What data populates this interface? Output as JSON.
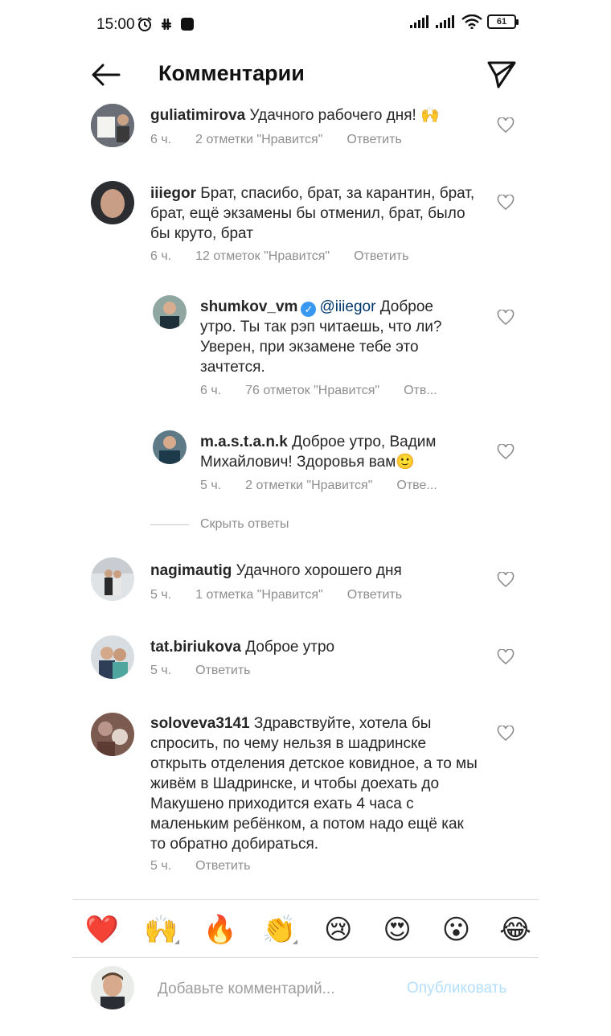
{
  "status": {
    "time": "15:00",
    "battery": "61"
  },
  "header": {
    "title": "Комментарии"
  },
  "comments": [
    {
      "username": "guliatimirova",
      "text": "Удачного рабочего дня! 🙌",
      "time": "6 ч.",
      "likes": "2 отметки \"Нравится\"",
      "reply": "Ответить"
    },
    {
      "username": "iiiegor",
      "text": "Брат, спасибо, брат, за карантин, брат, брат, ещё экзамены бы отменил, брат, было бы круто, брат",
      "time": "6 ч.",
      "likes": "12 отметок \"Нравится\"",
      "reply": "Ответить"
    },
    {
      "username": "shumkov_vm",
      "mention": "@iiiegor",
      "text": "Доброе утро. Ты так рэп читаешь, что ли? Уверен, при экзамене тебе это зачтется.",
      "time": "6 ч.",
      "likes": "76 отметок \"Нравится\"",
      "reply": "Отв..."
    },
    {
      "username": "m.a.s.t.a.n.k",
      "text": "Доброе утро, Вадим Михайлович! Здоровья вам🙂",
      "time": "5 ч.",
      "likes": "2 отметки \"Нравится\"",
      "reply": "Отве..."
    },
    {
      "username": "nagimautig",
      "text": "Удачного хорошего дня",
      "time": "5 ч.",
      "likes": "1 отметка \"Нравится\"",
      "reply": "Ответить"
    },
    {
      "username": "tat.biriukova",
      "text": "Доброе утро",
      "time": "5 ч.",
      "reply": "Ответить"
    },
    {
      "username": "soloveva3141",
      "text": "Здравствуйте, хотела бы спросить, по чему нельзя в шадринске открыть отделения детское ковидное, а то мы живём в Шадринске, и чтобы доехать до Макушено приходится ехать 4 часа с маленьким ребёнком, а потом надо ещё как то обратно добираться.",
      "time": "5 ч.",
      "reply": "Ответить"
    }
  ],
  "hide_replies": "Скрыть ответы",
  "emojis": [
    "❤️",
    "🙌",
    "🔥",
    "👏",
    "😢",
    "😍",
    "😮",
    "😂"
  ],
  "compose": {
    "placeholder": "Добавьте комментарий...",
    "publish": "Опубликовать"
  }
}
